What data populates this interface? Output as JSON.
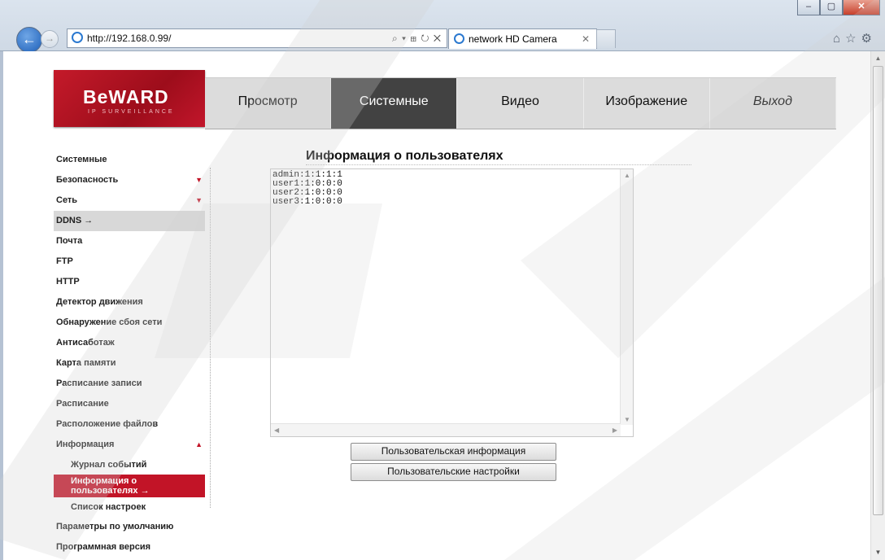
{
  "browser": {
    "url": "http://192.168.0.99/",
    "tab_title": "network HD Camera",
    "address_tools": "⌕ ▾ ⊞ ↻ ✕",
    "window_buttons": [
      "–",
      "▢",
      "✕"
    ]
  },
  "logo": {
    "brand": "BeWARD",
    "sub": "IP SURVEILLANCE"
  },
  "menu": {
    "items": [
      "Просмотр",
      "Системные",
      "Видео",
      "Изображение",
      "Выход"
    ],
    "active": "Системные"
  },
  "sidebar": {
    "items": [
      "Системные",
      "Безопасность",
      "Сеть",
      "DDNS →",
      "Почта",
      "FTP",
      "HTTP",
      "Детектор движения",
      "Обнаружение сбоя сети",
      "Антисаботаж",
      "Карта памяти",
      "Расписание записи",
      "Расписание",
      "Расположение файлов",
      "Информация",
      "Журнал событий",
      "Информация о пользователях →",
      "Список настроек",
      "Параметры по умолчанию",
      "Программная версия"
    ],
    "arrows": {
      "down": "▼",
      "up": "▲"
    }
  },
  "content": {
    "title": "Информация о пользователях",
    "user_lines": [
      "admin:1:1:1:1",
      "user1:1:0:0:0",
      "user2:1:0:0:0",
      "user3:1:0:0:0"
    ],
    "buttons": [
      "Пользовательская информация",
      "Пользовательские настройки"
    ]
  },
  "colors": {
    "accent": "#c21427",
    "menu_active": "#424242",
    "menu_bg": "#dcdcdc"
  }
}
